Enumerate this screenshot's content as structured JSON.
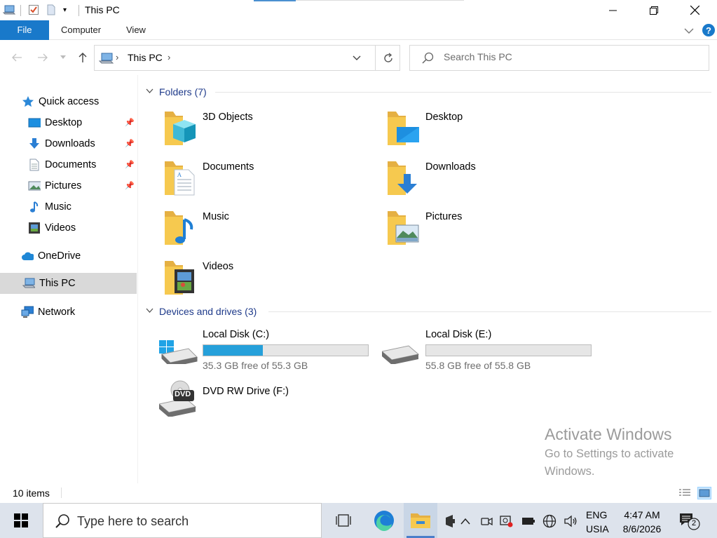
{
  "window": {
    "title": "This PC"
  },
  "ribbon": {
    "tabs": [
      "File",
      "Computer",
      "View"
    ]
  },
  "address": {
    "path": "This PC"
  },
  "search": {
    "placeholder": "Search This PC"
  },
  "sidebar": {
    "quick_access": "Quick access",
    "items": [
      {
        "label": "Desktop",
        "pinned": true
      },
      {
        "label": "Downloads",
        "pinned": true
      },
      {
        "label": "Documents",
        "pinned": true
      },
      {
        "label": "Pictures",
        "pinned": true
      },
      {
        "label": "Music",
        "pinned": false
      },
      {
        "label": "Videos",
        "pinned": false
      }
    ],
    "onedrive": "OneDrive",
    "this_pc": "This PC",
    "network": "Network"
  },
  "folders": {
    "header": "Folders (7)",
    "items": [
      "3D Objects",
      "Desktop",
      "Documents",
      "Downloads",
      "Music",
      "Pictures",
      "Videos"
    ]
  },
  "drives": {
    "header": "Devices and drives (3)",
    "items": [
      {
        "name": "Local Disk (C:)",
        "free": "35.3 GB free of 55.3 GB",
        "used_fraction": 0.362
      },
      {
        "name": "Local Disk (E:)",
        "free": "55.8 GB free of 55.8 GB",
        "used_fraction": 0.0
      },
      {
        "name": "DVD RW Drive (F:)"
      }
    ],
    "dvd_badge": "DVD"
  },
  "watermark": {
    "line1": "Activate Windows",
    "line2": "Go to Settings to activate Windows."
  },
  "status": {
    "items": "10 items"
  },
  "taskbar": {
    "search_placeholder": "Type here to search",
    "lang_top": "ENG",
    "lang_bottom": "USIA",
    "time": "4:47 AM",
    "date": "8/6/2026",
    "notification_count": "2"
  },
  "colors": {
    "accent": "#1979ca",
    "drive_fill": "#26a0da",
    "folder": "#f6c34a"
  }
}
